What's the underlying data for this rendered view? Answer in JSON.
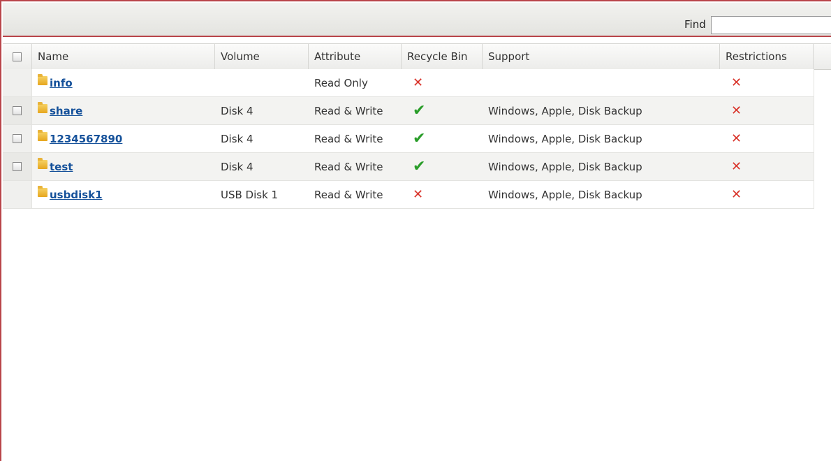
{
  "toolbar": {
    "find_label": "Find",
    "find_value": "",
    "find_placeholder": ""
  },
  "columns": {
    "name": "Name",
    "volume": "Volume",
    "attribute": "Attribute",
    "recycle_bin": "Recycle Bin",
    "support": "Support",
    "restrictions": "Restrictions"
  },
  "rows": [
    {
      "name": "info",
      "volume": "",
      "attribute": "Read Only",
      "recycle_bin": "cross-icon",
      "support": "",
      "restrictions": "cross-icon",
      "checkbox": false
    },
    {
      "name": "share",
      "volume": "Disk 4",
      "attribute": "Read & Write",
      "recycle_bin": "check-icon",
      "support": "Windows, Apple, Disk Backup",
      "restrictions": "cross-icon",
      "checkbox": true
    },
    {
      "name": "1234567890",
      "volume": "Disk 4",
      "attribute": "Read & Write",
      "recycle_bin": "check-icon",
      "support": "Windows, Apple, Disk Backup",
      "restrictions": "cross-icon",
      "checkbox": true
    },
    {
      "name": "test",
      "volume": "Disk 4",
      "attribute": "Read & Write",
      "recycle_bin": "check-icon",
      "support": "Windows, Apple, Disk Backup",
      "restrictions": "cross-icon",
      "checkbox": true
    },
    {
      "name": "usbdisk1",
      "volume": "USB Disk 1",
      "attribute": "Read & Write",
      "recycle_bin": "cross-icon",
      "support": "Windows, Apple, Disk Backup",
      "restrictions": "cross-icon",
      "checkbox": false
    }
  ],
  "colors": {
    "frame_border": "#b9454a",
    "link": "#15519a",
    "check": "#2a9d2a",
    "cross": "#d9342b"
  }
}
